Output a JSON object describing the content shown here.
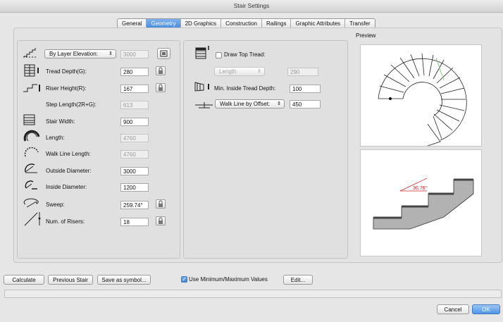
{
  "window": {
    "title": "Stair Settings"
  },
  "tabs": [
    {
      "label": "General",
      "active": false
    },
    {
      "label": "Geometry",
      "active": true
    },
    {
      "label": "2D Graphics",
      "active": false
    },
    {
      "label": "Construction",
      "active": false
    },
    {
      "label": "Railings",
      "active": false
    },
    {
      "label": "Graphic Attributes",
      "active": false
    },
    {
      "label": "Transfer",
      "active": false
    }
  ],
  "geometry": {
    "elevation_popup": "By Layer Elevation:",
    "elevation_value": "3000",
    "tread_depth": {
      "label": "Tread Depth(G):",
      "value": "280"
    },
    "riser_height": {
      "label": "Riser Height(R):",
      "value": "167"
    },
    "step_length": {
      "label": "Step Length(2R+G):",
      "value": "613"
    },
    "stair_width": {
      "label": "Stair Width:",
      "value": "900"
    },
    "length": {
      "label": "Length:",
      "value": "4760"
    },
    "walk_line_length": {
      "label": "Walk Line Length:",
      "value": "4760"
    },
    "outside_diameter": {
      "label": "Outside Diameter:",
      "value": "3000"
    },
    "inside_diameter": {
      "label": "Inside Diameter:",
      "value": "1200"
    },
    "sweep": {
      "label": "Sweep:",
      "value": "259.74°"
    },
    "num_risers": {
      "label": "Num. of Risers:",
      "value": "18"
    }
  },
  "tread": {
    "draw_top_tread_label": "Draw Top Tread:",
    "draw_top_tread_checked": false,
    "length_popup": "Length",
    "length_value": "290",
    "min_inside_label": "Min. Inside Tread Depth:",
    "min_inside_value": "100",
    "walk_line_popup": "Walk Line by Offset:",
    "walk_line_value": "450"
  },
  "preview": {
    "label": "Preview",
    "angle_label": "30.76°"
  },
  "bottom": {
    "calculate": "Calculate",
    "previous_stair": "Previous Stair",
    "save_as_symbol": "Save as symbol...",
    "use_minmax_label": "Use Minimum/Maximum Values",
    "use_minmax_checked": true,
    "edit": "Edit...",
    "cancel": "Cancel",
    "ok": "OK"
  },
  "colors": {
    "accent": "#3f86e0",
    "walk_line": "#7fd07f",
    "angle_red": "#d42020"
  }
}
